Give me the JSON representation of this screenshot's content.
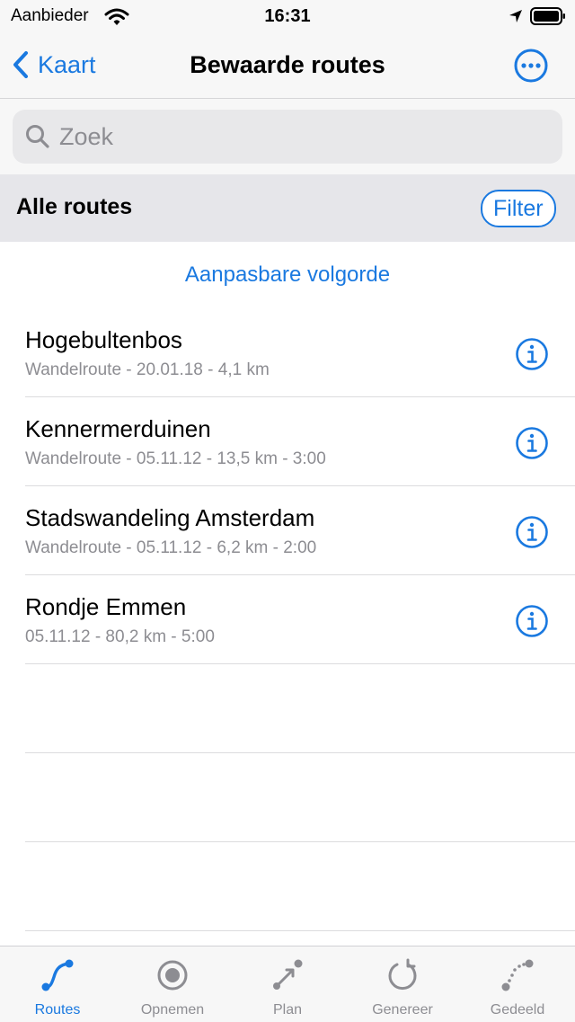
{
  "status_bar": {
    "carrier": "Aanbieder",
    "time": "16:31"
  },
  "nav": {
    "back_label": "Kaart",
    "title": "Bewaarde routes",
    "more_icon": "ellipsis-circle-icon"
  },
  "search": {
    "placeholder": "Zoek",
    "value": ""
  },
  "section": {
    "title": "Alle routes",
    "filter_label": "Filter"
  },
  "sort_label": "Aanpasbare volgorde",
  "routes": [
    {
      "name": "Hogebultenbos",
      "meta": "Wandelroute - 20.01.18 - 4,1 km"
    },
    {
      "name": "Kennermerduinen",
      "meta": "Wandelroute - 05.11.12 - 13,5 km - 3:00"
    },
    {
      "name": "Stadswandeling Amsterdam",
      "meta": "Wandelroute - 05.11.12 - 6,2 km - 2:00"
    },
    {
      "name": "Rondje Emmen",
      "meta": "05.11.12 - 80,2 km - 5:00"
    }
  ],
  "tabs": [
    {
      "label": "Routes",
      "icon": "route-path-icon",
      "active": true
    },
    {
      "label": "Opnemen",
      "icon": "record-icon",
      "active": false
    },
    {
      "label": "Plan",
      "icon": "plan-arrow-icon",
      "active": false
    },
    {
      "label": "Genereer",
      "icon": "refresh-icon",
      "active": false
    },
    {
      "label": "Gedeeld",
      "icon": "shared-path-icon",
      "active": false
    }
  ],
  "colors": {
    "accent": "#1a79e0",
    "secondary_text": "#8d8d92",
    "inactive_icon": "#8d8d92"
  }
}
